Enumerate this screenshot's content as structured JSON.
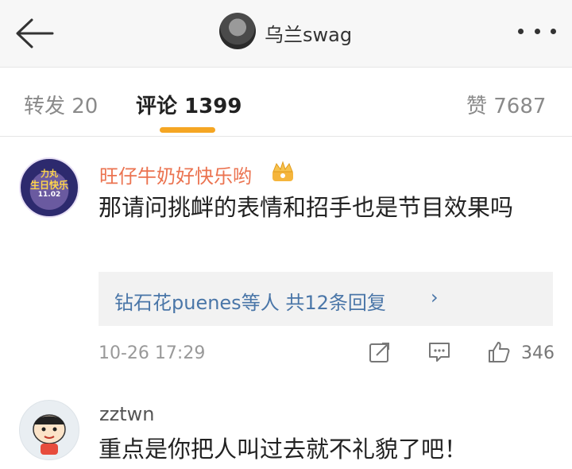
{
  "header": {
    "title": "乌兰swag",
    "back_icon": "arrow-left-icon",
    "more_icon": "more-dots-icon"
  },
  "tabs": {
    "repost": "转发 20",
    "comments": "评论 1399",
    "likes": "赞 7687",
    "accent": "#f5a623"
  },
  "comments": [
    {
      "user": "旺仔牛奶好快乐哟",
      "avatar_text_top": "力丸",
      "avatar_text_mid": "生日快乐",
      "avatar_text_bot": "11.02",
      "text": "那请问挑衅的表情和招手也是节目效果吗",
      "reply_summary": "钻石花puenes等人  共12条回复",
      "reply_chevron": "›",
      "time": "10-26 17:29",
      "likes": "346"
    },
    {
      "user": "zztwn",
      "text": "重点是你把人叫过去就不礼貌了吧！"
    }
  ],
  "colors": {
    "username_vip": "#eb7350",
    "link": "#4a76a8"
  }
}
